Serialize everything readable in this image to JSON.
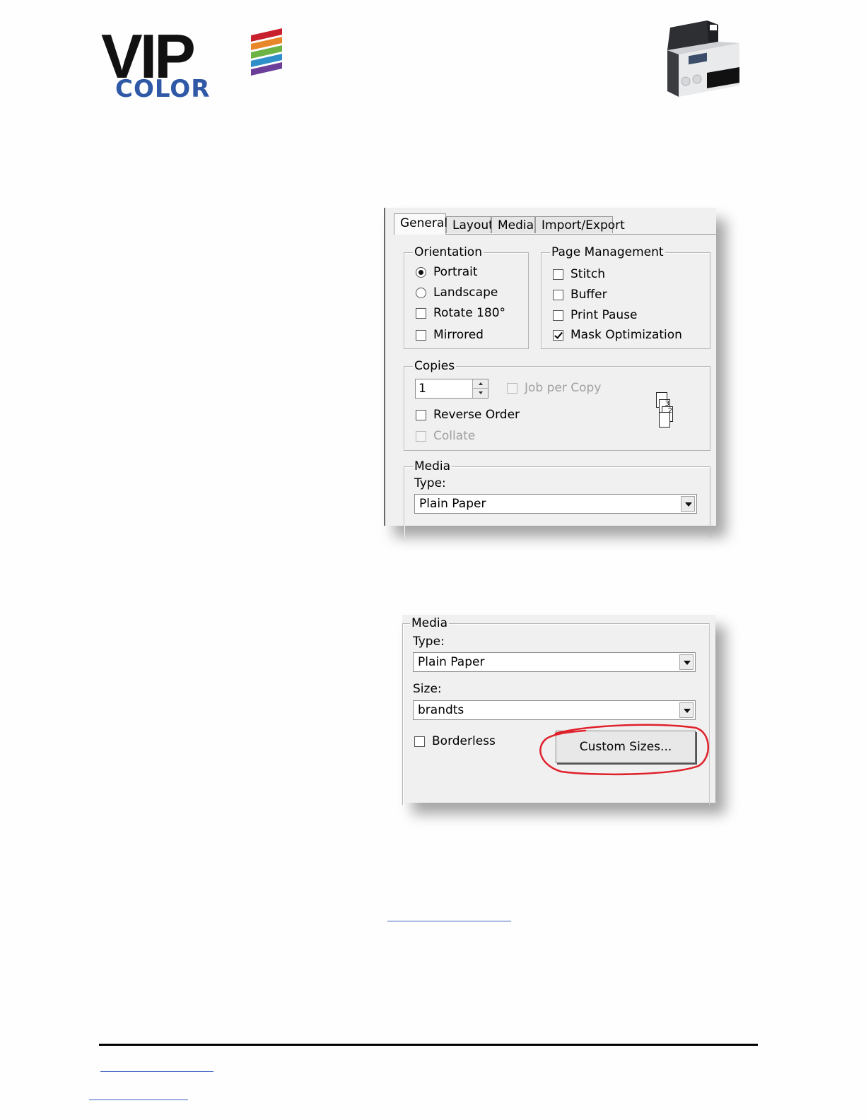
{
  "logo": {
    "line1": "VIP",
    "line2": "COLOR",
    "stripe_colors": [
      "#c8202c",
      "#e8872a",
      "#6cb344",
      "#2f8fc9",
      "#6b3f99"
    ]
  },
  "printer_image": "printer-photo",
  "dialog_general": {
    "tabs": [
      "General",
      "Layout",
      "Media",
      "Import/Export"
    ],
    "active_tab": "General",
    "orientation": {
      "title": "Orientation",
      "portrait": "Portrait",
      "landscape": "Landscape",
      "rotate": "Rotate 180°",
      "mirrored": "Mirrored"
    },
    "page_management": {
      "title": "Page Management",
      "stitch": "Stitch",
      "buffer": "Buffer",
      "print_pause": "Print Pause",
      "mask_optimization": "Mask Optimization"
    },
    "copies": {
      "title": "Copies",
      "value": "1",
      "job_per_copy": "Job per Copy",
      "reverse_order": "Reverse Order",
      "collate": "Collate",
      "collate_icon": [
        "3",
        "2"
      ]
    },
    "media": {
      "title": "Media",
      "type_label": "Type:",
      "type_value": "Plain Paper"
    }
  },
  "dialog_media": {
    "title": "Media",
    "type_label": "Type:",
    "type_value": "Plain Paper",
    "size_label": "Size:",
    "size_value": "brandts",
    "borderless": "Borderless",
    "custom_sizes_button": "Custom Sizes...",
    "highlight_color": "#e0202a"
  },
  "colors": {
    "link": "#3b5fc0",
    "rule": "#000000"
  }
}
